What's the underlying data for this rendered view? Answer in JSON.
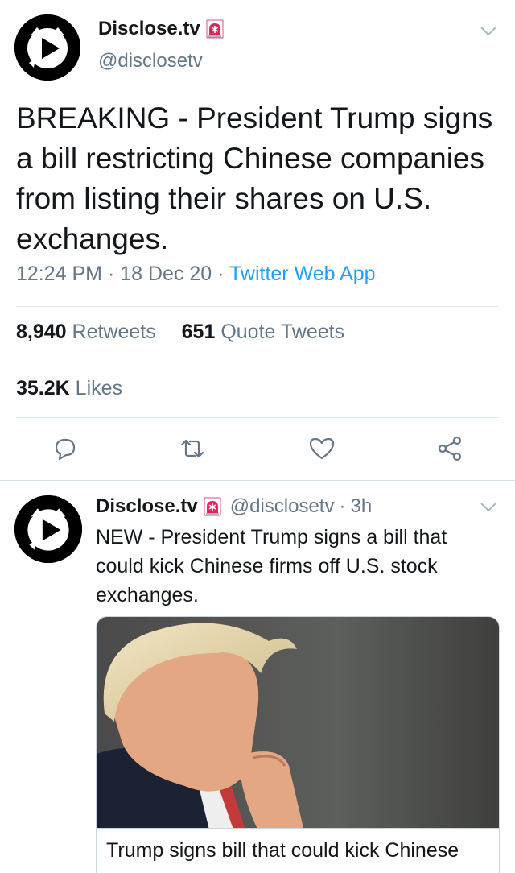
{
  "main_tweet": {
    "display_name": "Disclose.tv",
    "badge_icon": "siren-emoji",
    "handle": "@disclosetv",
    "text": "BREAKING - President Trump signs a bill restricting Chinese companies from listing their shares on U.S. exchanges.",
    "time": "12:24 PM",
    "date": "18 Dec 20",
    "source": "Twitter Web App",
    "separator": "·",
    "retweets_count": "8,940",
    "retweets_label": "Retweets",
    "quote_count": "651",
    "quote_label": "Quote Tweets",
    "likes_count": "35.2K",
    "likes_label": "Likes",
    "actions": [
      "reply-icon",
      "retweet-icon",
      "like-icon",
      "share-icon"
    ]
  },
  "second_tweet": {
    "display_name": "Disclose.tv",
    "badge_icon": "siren-emoji",
    "handle": "@disclosetv",
    "separator": "·",
    "age": "3h",
    "text": "NEW - President Trump signs a bill that could kick Chinese firms off U.S. stock exchanges.",
    "card_title": "Trump signs bill that could kick Chinese"
  },
  "colors": {
    "text": "#14171a",
    "muted": "#657786",
    "link": "#1da1f2",
    "divider": "#e1e8ed",
    "siren_red": "#e0245e"
  }
}
